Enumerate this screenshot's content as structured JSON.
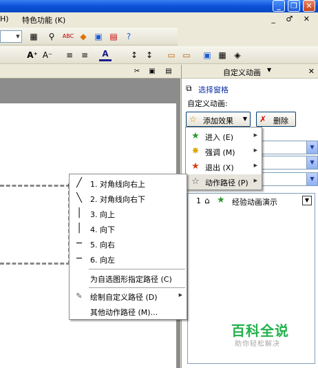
{
  "menubar": {
    "left_fragment": "H)",
    "special": "特色功能 (K)"
  },
  "mdi_controls": "_ ♂ ✕",
  "taskpane": {
    "title": "自定义动画",
    "select_pane_link": "选择窗格",
    "label": "自定义动画:",
    "add_effect_button": "添加效果",
    "delete_button": "删除"
  },
  "add_effect_menu": [
    {
      "label": "进入 (E)",
      "icon": "star-green-icon"
    },
    {
      "label": "强调 (M)",
      "icon": "star-yellow-icon"
    },
    {
      "label": "退出 (X)",
      "icon": "star-red-icon"
    },
    {
      "label": "动作路径 (P)",
      "icon": "star-outline-icon"
    }
  ],
  "motion_path_menu": [
    {
      "label": "1. 对角线向右上",
      "glyph": "╱"
    },
    {
      "label": "2. 对角线向右下",
      "glyph": "╲"
    },
    {
      "label": "3. 向上",
      "glyph": "│"
    },
    {
      "label": "4. 向下",
      "glyph": "│"
    },
    {
      "label": "5. 向右",
      "glyph": "─"
    },
    {
      "label": "6. 向左",
      "glyph": "─"
    },
    {
      "label": "为自选图形指定路径 (C)"
    },
    {
      "label": "绘制自定义路径 (D)"
    },
    {
      "label": "其他动作路径 (M)..."
    }
  ],
  "animation_list": [
    {
      "order": "1",
      "name": "经验动画演示"
    }
  ],
  "watermark": {
    "title": "百科全说",
    "subtitle": "助你轻松解决"
  }
}
